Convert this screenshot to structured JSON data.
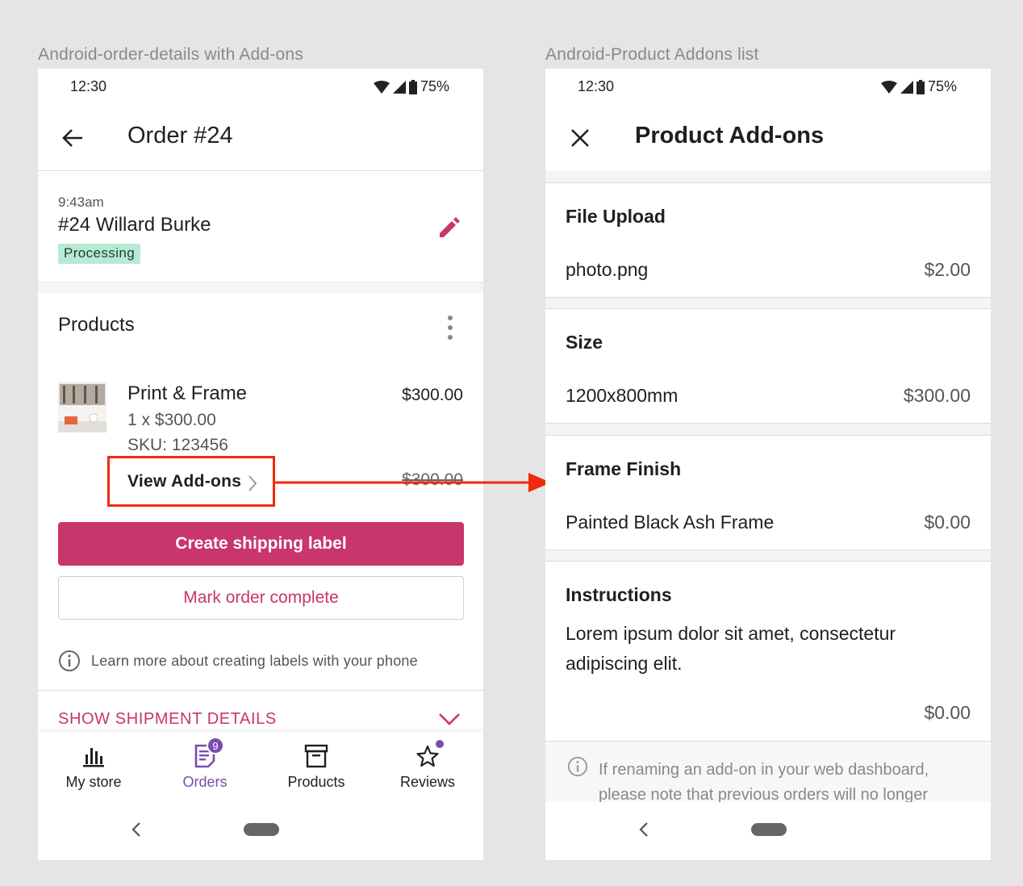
{
  "frames": {
    "left_label": "Android-order-details with Add-ons",
    "right_label": "Android-Product Addons list"
  },
  "status_bar": {
    "time": "12:30",
    "battery": "75%"
  },
  "order_details": {
    "title": "Order #24",
    "order_time": "9:43am",
    "order_name": "#24 Willard Burke",
    "status": "Processing",
    "products_section_title": "Products",
    "product": {
      "name": "Print & Frame",
      "total": "$300.00",
      "quantity_line": "1 x $300.00",
      "sku": "SKU: 123456",
      "view_addons_label": "View Add-ons",
      "strikethrough_total": "$300.00"
    },
    "create_shipping_label": "Create shipping label",
    "mark_order_complete": "Mark order complete",
    "learn_more": "Learn more about creating labels with your phone",
    "show_shipment_details": "SHOW SHIPMENT DETAILS"
  },
  "bottom_nav": [
    {
      "label": "My store",
      "icon": "bar-chart-icon",
      "active": false
    },
    {
      "label": "Orders",
      "icon": "orders-icon",
      "active": true,
      "badge": "9"
    },
    {
      "label": "Products",
      "icon": "archive-box-icon",
      "active": false
    },
    {
      "label": "Reviews",
      "icon": "star-icon",
      "active": false
    }
  ],
  "addons_list": {
    "title": "Product Add-ons",
    "items": [
      {
        "name": "File Upload",
        "value": "photo.png",
        "price": "$2.00"
      },
      {
        "name": "Size",
        "value": "1200x800mm",
        "price": "$300.00"
      },
      {
        "name": "Frame Finish",
        "value": "Painted Black Ash Frame",
        "price": "$0.00"
      },
      {
        "name": "Instructions",
        "value": "Lorem ipsum dolor sit amet, consectetur adipiscing elit.",
        "price": "$0.00"
      }
    ],
    "notice": "If renaming an add-on in your web dashboard, please note that previous orders will no longer"
  },
  "colors": {
    "accent_pink": "#c9356d",
    "active_purple": "#7a4bb0",
    "status_green": "#b7ead4",
    "highlight_red": "#f02a0c"
  }
}
